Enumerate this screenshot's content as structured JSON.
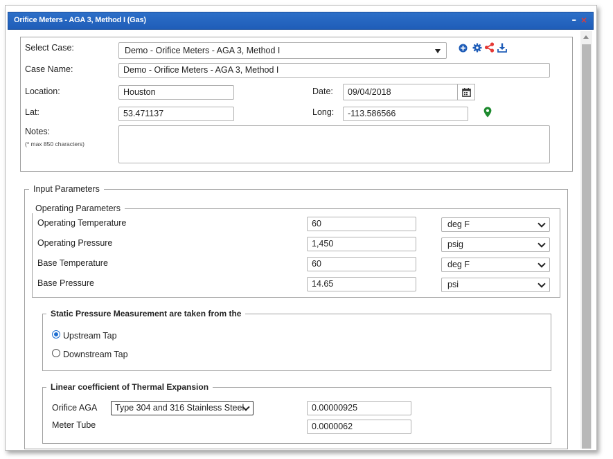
{
  "window": {
    "title": "Orifice Meters - AGA 3, Method I (Gas)",
    "minimize_glyph": "–",
    "close_glyph": "×"
  },
  "case": {
    "select_label": "Select Case:",
    "select_value": "Demo - Orifice Meters - AGA 3, Method I",
    "name_label": "Case Name:",
    "name_value": "Demo - Orifice Meters - AGA 3, Method I",
    "location_label": "Location:",
    "location_value": "Houston",
    "date_label": "Date:",
    "date_value": "09/04/2018",
    "lat_label": "Lat:",
    "lat_value": "53.471137",
    "long_label": "Long:",
    "long_value": "-113.586566",
    "notes_label": "Notes:",
    "notes_hint": "(* max 850 characters)",
    "notes_value": "",
    "icons": [
      "add-icon",
      "gear-icon",
      "share-icon",
      "download-icon",
      "calendar-icon",
      "map-pin-icon"
    ],
    "icon_colors": {
      "add": "#1f5db8",
      "gear": "#1f5db8",
      "share": "#e53935",
      "download": "#1f5db8",
      "pin": "#1e8a2e"
    }
  },
  "input_parameters": {
    "title": "Input Parameters",
    "operating": {
      "title": "Operating Parameters",
      "rows": [
        {
          "label": "Operating Temperature",
          "value": "60",
          "unit": "deg F"
        },
        {
          "label": "Operating Pressure",
          "value": "1,450",
          "unit": "psig"
        },
        {
          "label": "Base Temperature",
          "value": "60",
          "unit": "deg F"
        },
        {
          "label": "Base Pressure",
          "value": "14.65",
          "unit": "psi"
        }
      ]
    },
    "static_pressure": {
      "title": "Static Pressure Measurement are taken from the",
      "options": [
        "Upstream Tap",
        "Downstream Tap"
      ],
      "selected": "Upstream Tap"
    },
    "thermal": {
      "title": "Linear coefficient of Thermal Expansion",
      "orifice_label": "Orifice AGA",
      "orifice_material": "Type 304 and 316 Stainless Steel",
      "orifice_value": "0.00000925",
      "tube_label": "Meter Tube",
      "tube_value": "0.0000062"
    }
  },
  "colors": {
    "titlebar": "#2566c4",
    "close": "#e53935",
    "radio": "#1f6fd1"
  }
}
